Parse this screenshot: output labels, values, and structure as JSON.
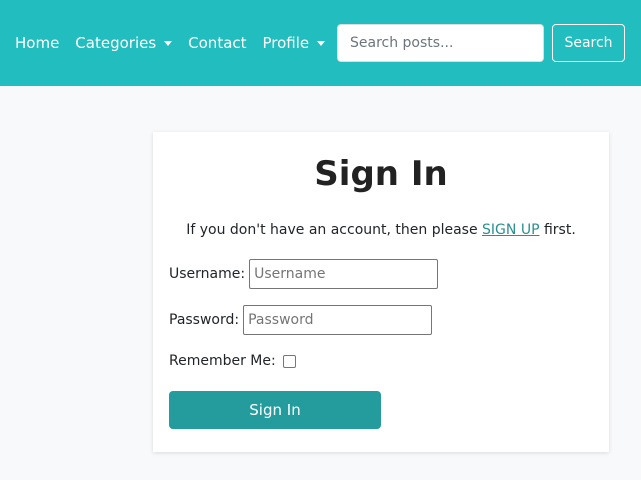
{
  "nav": {
    "items": [
      {
        "label": "Home",
        "dropdown": false
      },
      {
        "label": "Categories",
        "dropdown": true
      },
      {
        "label": "Contact",
        "dropdown": false
      },
      {
        "label": "Profile",
        "dropdown": true
      }
    ],
    "search": {
      "placeholder": "Search posts...",
      "value": "",
      "button_label": "Search"
    },
    "background_color": "#22bdbe"
  },
  "signin": {
    "title": "Sign In",
    "info_prefix": "If you don't have an account, then please ",
    "info_link": "SIGN UP",
    "info_suffix": " first.",
    "username_label": "Username:",
    "username_placeholder": "Username",
    "password_label": "Password:",
    "password_placeholder": "Password",
    "remember_label": "Remember Me:",
    "remember_checked": false,
    "submit_label": "Sign In",
    "submit_color": "#249c9e"
  }
}
